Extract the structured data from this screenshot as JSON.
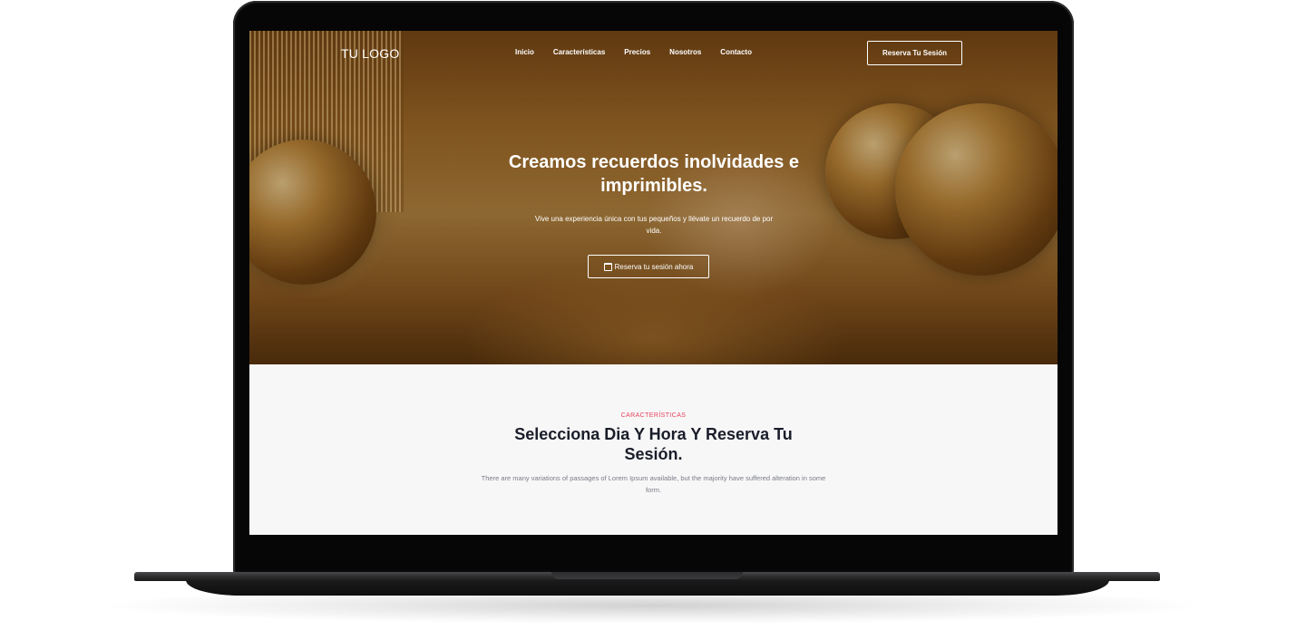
{
  "nav": {
    "logo": "TU LOGO",
    "items": [
      "Inicio",
      "Características",
      "Precios",
      "Nosotros",
      "Contacto"
    ],
    "cta": "Reserva Tu Sesión"
  },
  "hero": {
    "title": "Creamos recuerdos inolvidades e imprimibles.",
    "subtitle": "Vive una experiencia única con tus pequeños y llévate un recuerdo de por vida.",
    "cta": "Reserva tu sesión ahora",
    "cta_icon": "calendar-icon"
  },
  "features": {
    "kicker": "CARACTERÍSTICAS",
    "title": "Selecciona Dia Y Hora Y Reserva Tu Sesión.",
    "description": "There are many variations of passages of Lorem Ipsum available, but the majority have suffered alteration in some form."
  },
  "colors": {
    "accent": "#e5425a",
    "heading": "#1a1d29",
    "section_bg": "#f7f7f8"
  }
}
